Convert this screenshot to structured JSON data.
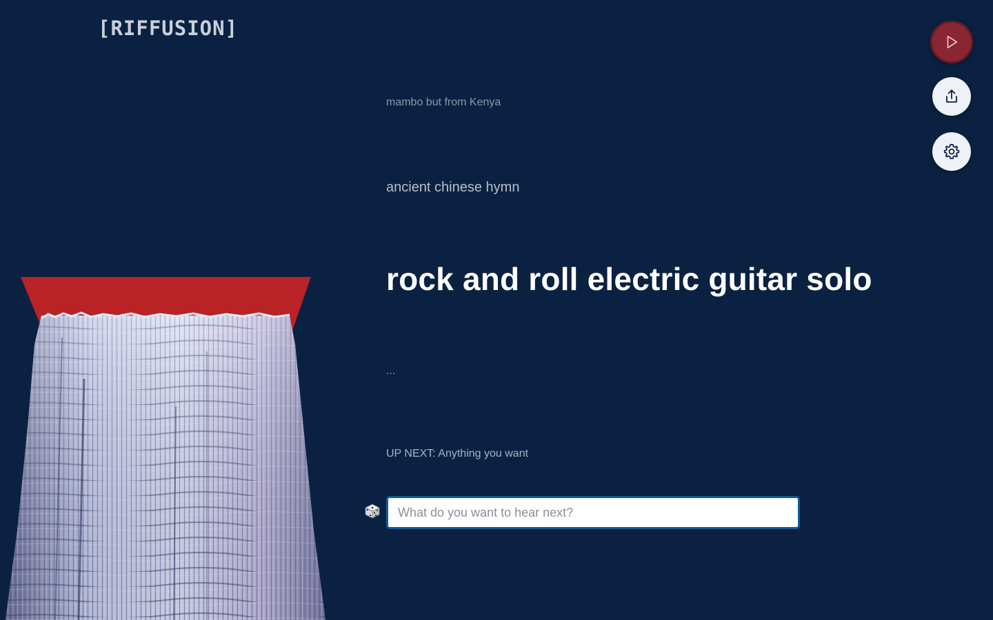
{
  "app": {
    "logo": "[RIFFUSION]"
  },
  "prompts": {
    "past_2": "mambo but from Kenya",
    "past_1": "ancient chinese hymn",
    "current": "rock and roll electric guitar solo",
    "next_placeholder": "..."
  },
  "up_next": {
    "label": "UP NEXT: Anything you want"
  },
  "input": {
    "placeholder": "What do you want to hear next?",
    "value": ""
  },
  "controls": {
    "play_icon": "play-icon",
    "share_icon": "share-icon",
    "settings_icon": "gear-icon",
    "dice_icon": "dice-icon"
  },
  "colors": {
    "background": "#0b2142",
    "play_button": "#8a2631",
    "spectrogram_top": "#b92326",
    "input_border": "#0f5e9c"
  }
}
